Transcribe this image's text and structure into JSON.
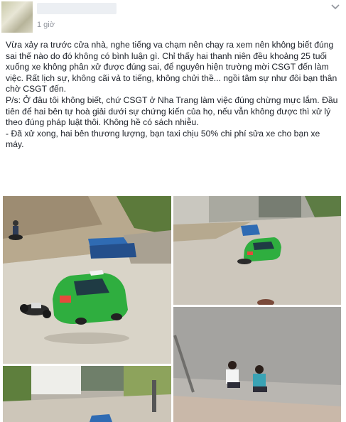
{
  "post": {
    "time": "1 giờ",
    "paragraphs": [
      "Vừa xảy ra trước cửa nhà, nghe tiếng va chạm nên chạy ra xem nên không biết đúng sai thế nào do đó không có bình luận gì. Chỉ thấy hai thanh niên đều khoảng 25 tuổi xuống xe không phân xử được đúng sai, để nguyên hiện trường mời CSGT đến làm việc. Rất lịch sự, không cãi vả to tiếng, không chửi thề... ngồi tâm sự như đôi bạn thân chờ CSGT đến.",
      "P/s: Ở đâu tôi không biết, chứ CSGT ở Nha Trang làm việc đúng chừng mực lắm. Đầu tiên để hai bên tự hoà giải dưới sự chứng kiến của họ, nếu vẫn không được thì xử lý theo đúng pháp luật thôi. Không hề có sách nhiễu.",
      "- Đã xử xong, hai bên thương lượng, bạn taxi chịu 50% chi phí sửa xe cho bạn xe máy."
    ]
  },
  "colors": {
    "taxi": "#2fae3f",
    "tarp": "#2f6bb3",
    "road": "#d7d2c6",
    "meta": "#90949c"
  }
}
